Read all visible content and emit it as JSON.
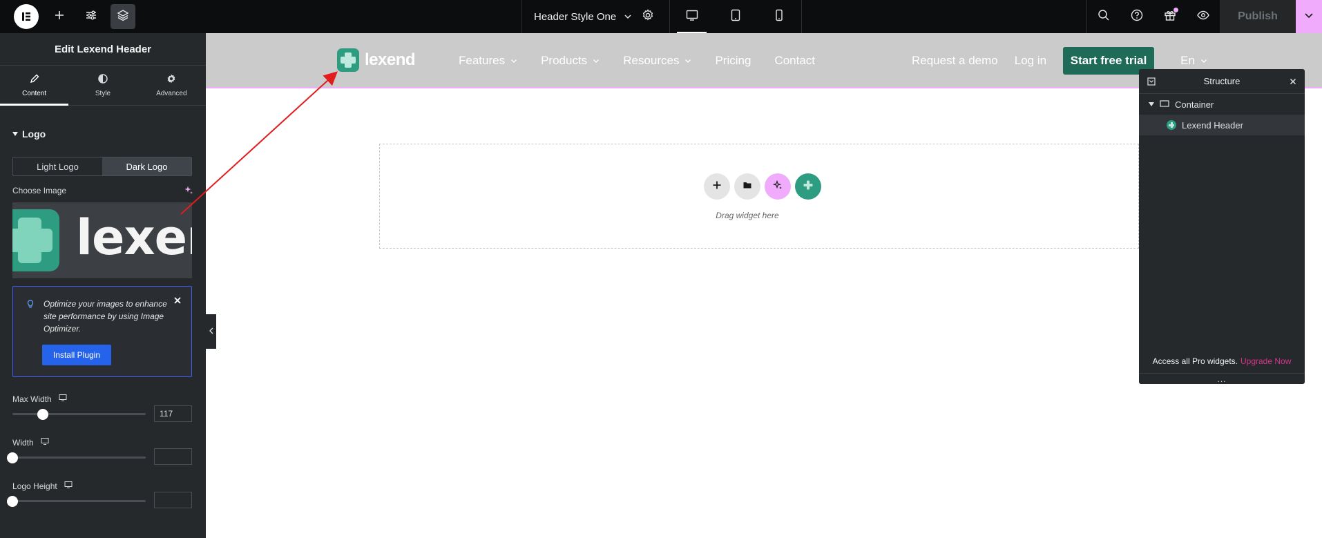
{
  "topbar": {
    "document_title": "Header Style One",
    "publish_label": "Publish",
    "icons": [
      "elementor-logo-icon",
      "plus-icon",
      "sliders-icon",
      "layers-icon",
      "chevron-down-icon",
      "gear-icon",
      "desktop-icon",
      "tablet-icon",
      "mobile-icon",
      "search-icon",
      "help-icon",
      "gift-icon",
      "eye-icon",
      "chevron-down-icon"
    ],
    "active_device": "desktop"
  },
  "panel": {
    "title": "Edit Lexend Header",
    "tabs": [
      {
        "label": "Content",
        "icon": "pencil-icon",
        "active": true
      },
      {
        "label": "Style",
        "icon": "half-circle-icon",
        "active": false
      },
      {
        "label": "Advanced",
        "icon": "gear-icon",
        "active": false
      }
    ],
    "section_title": "Logo",
    "logo_switcher": {
      "options": [
        "Light Logo",
        "Dark Logo"
      ],
      "selected": "Dark Logo"
    },
    "choose_image_label": "Choose Image",
    "preview_word": "lexend",
    "notice": {
      "text": "Optimize your images to enhance site performance by using Image Optimizer.",
      "button_label": "Install Plugin"
    },
    "controls": [
      {
        "label": "Max Width",
        "value": "117"
      },
      {
        "label": "Width",
        "value": ""
      },
      {
        "label": "Logo Height",
        "value": ""
      }
    ]
  },
  "site": {
    "logo_word": "lexend",
    "nav": [
      {
        "label": "Features",
        "dropdown": true
      },
      {
        "label": "Products",
        "dropdown": true
      },
      {
        "label": "Resources",
        "dropdown": true
      },
      {
        "label": "Pricing",
        "dropdown": false
      },
      {
        "label": "Contact",
        "dropdown": false
      }
    ],
    "request_demo": "Request a demo",
    "login": "Log in",
    "trial": "Start free trial",
    "lang": "En",
    "drop_label": "Drag widget here"
  },
  "structure": {
    "title": "Structure",
    "container_label": "Container",
    "widget_label": "Lexend Header",
    "footer_text": "Access all Pro widgets.",
    "upgrade_label": "Upgrade Now",
    "dots": "..."
  },
  "colors": {
    "topbar_bg": "#0c0d0e",
    "panel_bg": "#26292c",
    "accent_pink": "#f0abfc",
    "brand_green": "#2e9c80",
    "trial_green": "#1f6b58",
    "install_blue": "#2563eb",
    "upgrade_pink": "#d6338d",
    "annotation_arrow": "#e11d1d"
  }
}
